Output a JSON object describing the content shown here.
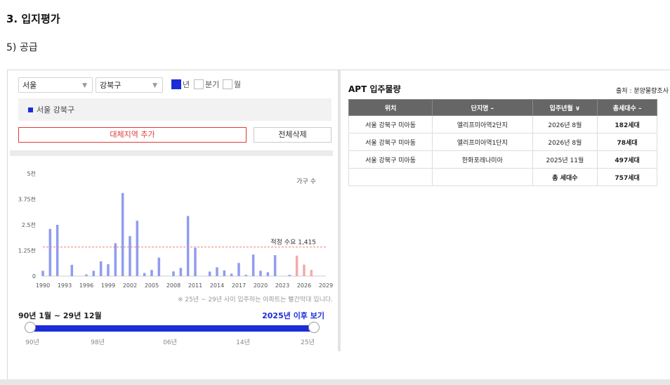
{
  "heading": {
    "section": "3. 입지평가",
    "subsection": "5) 공급"
  },
  "controls": {
    "city_select": "서울",
    "district_select": "강북구",
    "periods": [
      {
        "label": "년",
        "checked": true
      },
      {
        "label": "분기",
        "checked": false
      },
      {
        "label": "월",
        "checked": false
      }
    ],
    "selected_region": "서울 강북구",
    "add_region_button": "대체지역 추가",
    "delete_all_button": "전체삭제"
  },
  "chart_data": {
    "type": "bar",
    "y_unit_label": "가구 수",
    "ylim": [
      0,
      5000
    ],
    "y_ticks": [
      "0",
      "1.25천",
      "2.5천",
      "3.75천",
      "5천"
    ],
    "x_ticks": [
      "1990",
      "1993",
      "1996",
      "1999",
      "2002",
      "2005",
      "2008",
      "2011",
      "2014",
      "2017",
      "2020",
      "2023",
      "2026",
      "2029"
    ],
    "x": [
      1990,
      1991,
      1992,
      1993,
      1994,
      1995,
      1996,
      1997,
      1998,
      1999,
      2000,
      2001,
      2002,
      2003,
      2004,
      2005,
      2006,
      2007,
      2008,
      2009,
      2010,
      2011,
      2012,
      2013,
      2014,
      2015,
      2016,
      2017,
      2018,
      2019,
      2020,
      2021,
      2022,
      2023,
      2024,
      2025,
      2026,
      2027,
      2028,
      2029
    ],
    "values": [
      260,
      2300,
      2500,
      0,
      550,
      0,
      80,
      260,
      720,
      580,
      1600,
      4050,
      1950,
      2700,
      150,
      300,
      900,
      0,
      230,
      400,
      2930,
      1380,
      0,
      220,
      430,
      280,
      120,
      640,
      60,
      1050,
      260,
      190,
      1020,
      0,
      60,
      1000,
      560,
      300,
      0,
      0
    ],
    "highlight_from": 2025,
    "colors": {
      "normal": "#8f9cef",
      "highlight": "#f4aaaa",
      "reference": "#f08080"
    },
    "reference_line": {
      "label": "적정 수요 1,415",
      "value": 1415
    },
    "note": "※ 25년 ~ 29년 사이 입주하는 아파트는 빨간막대 입니다."
  },
  "range": {
    "label": "90년 1월 ~ 29년 12월",
    "link": "2025년 이후 보기",
    "ticks": [
      "90년",
      "98년",
      "06년",
      "14년",
      "25년"
    ]
  },
  "apt": {
    "title": "APT 입주물량",
    "source": "출처 : 분양물량조사",
    "headers": [
      "위치",
      "단지명 –",
      "입주년월 ∨",
      "총세대수 –"
    ],
    "rows": [
      [
        "서울 강북구 미아동",
        "엘리프미아역2단지",
        "2026년 8월",
        "182세대"
      ],
      [
        "서울 강북구 미아동",
        "엘리프미아역1단지",
        "2026년 8월",
        "78세대"
      ],
      [
        "서울 강북구 미아동",
        "한화포레나미아",
        "2025년 11월",
        "497세대"
      ],
      [
        "",
        "",
        "총 세대수",
        "757세대"
      ]
    ]
  }
}
